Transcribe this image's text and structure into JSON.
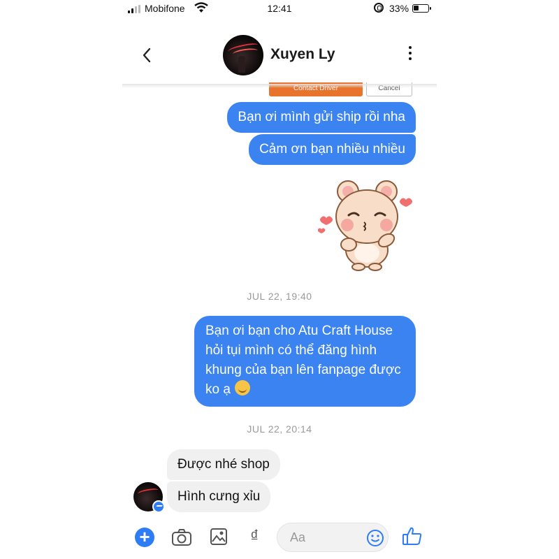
{
  "status_bar": {
    "carrier": "Mobifone",
    "time": "12:41",
    "battery": "33%"
  },
  "header": {
    "contact_name": "Xuyen Ly"
  },
  "action_buttons": {
    "contact_driver": "Contact Driver",
    "cancel": "Cancel"
  },
  "messages": {
    "sent_1": "Bạn ơi mình gửi ship rồi nha",
    "sent_2": "Cảm ơn bạn nhiều nhiều",
    "timestamp_1": "JUL 22, 19:40",
    "sent_3": "Bạn ơi bạn cho Atu Craft House hỏi tụi mình có thể đăng hình khung của bạn lên fanpage được ko ạ",
    "timestamp_2": "JUL 22, 20:14",
    "received_1": "Được nhé shop",
    "received_2": "Hình cưng xỉu"
  },
  "composer": {
    "placeholder": "Aa",
    "currency_symbol": "₫"
  },
  "colors": {
    "sent_bubble": "#3a83f1",
    "received_bubble": "#f0f0f0",
    "accent": "#2e7cf6",
    "contact_driver": "#e8732c"
  },
  "icons": {
    "back": "chevron-left-icon",
    "more": "more-vertical-icon",
    "plus": "plus-circle-icon",
    "camera": "camera-icon",
    "gallery": "image-icon",
    "emoji": "smiley-icon",
    "like": "thumbs-up-icon"
  }
}
